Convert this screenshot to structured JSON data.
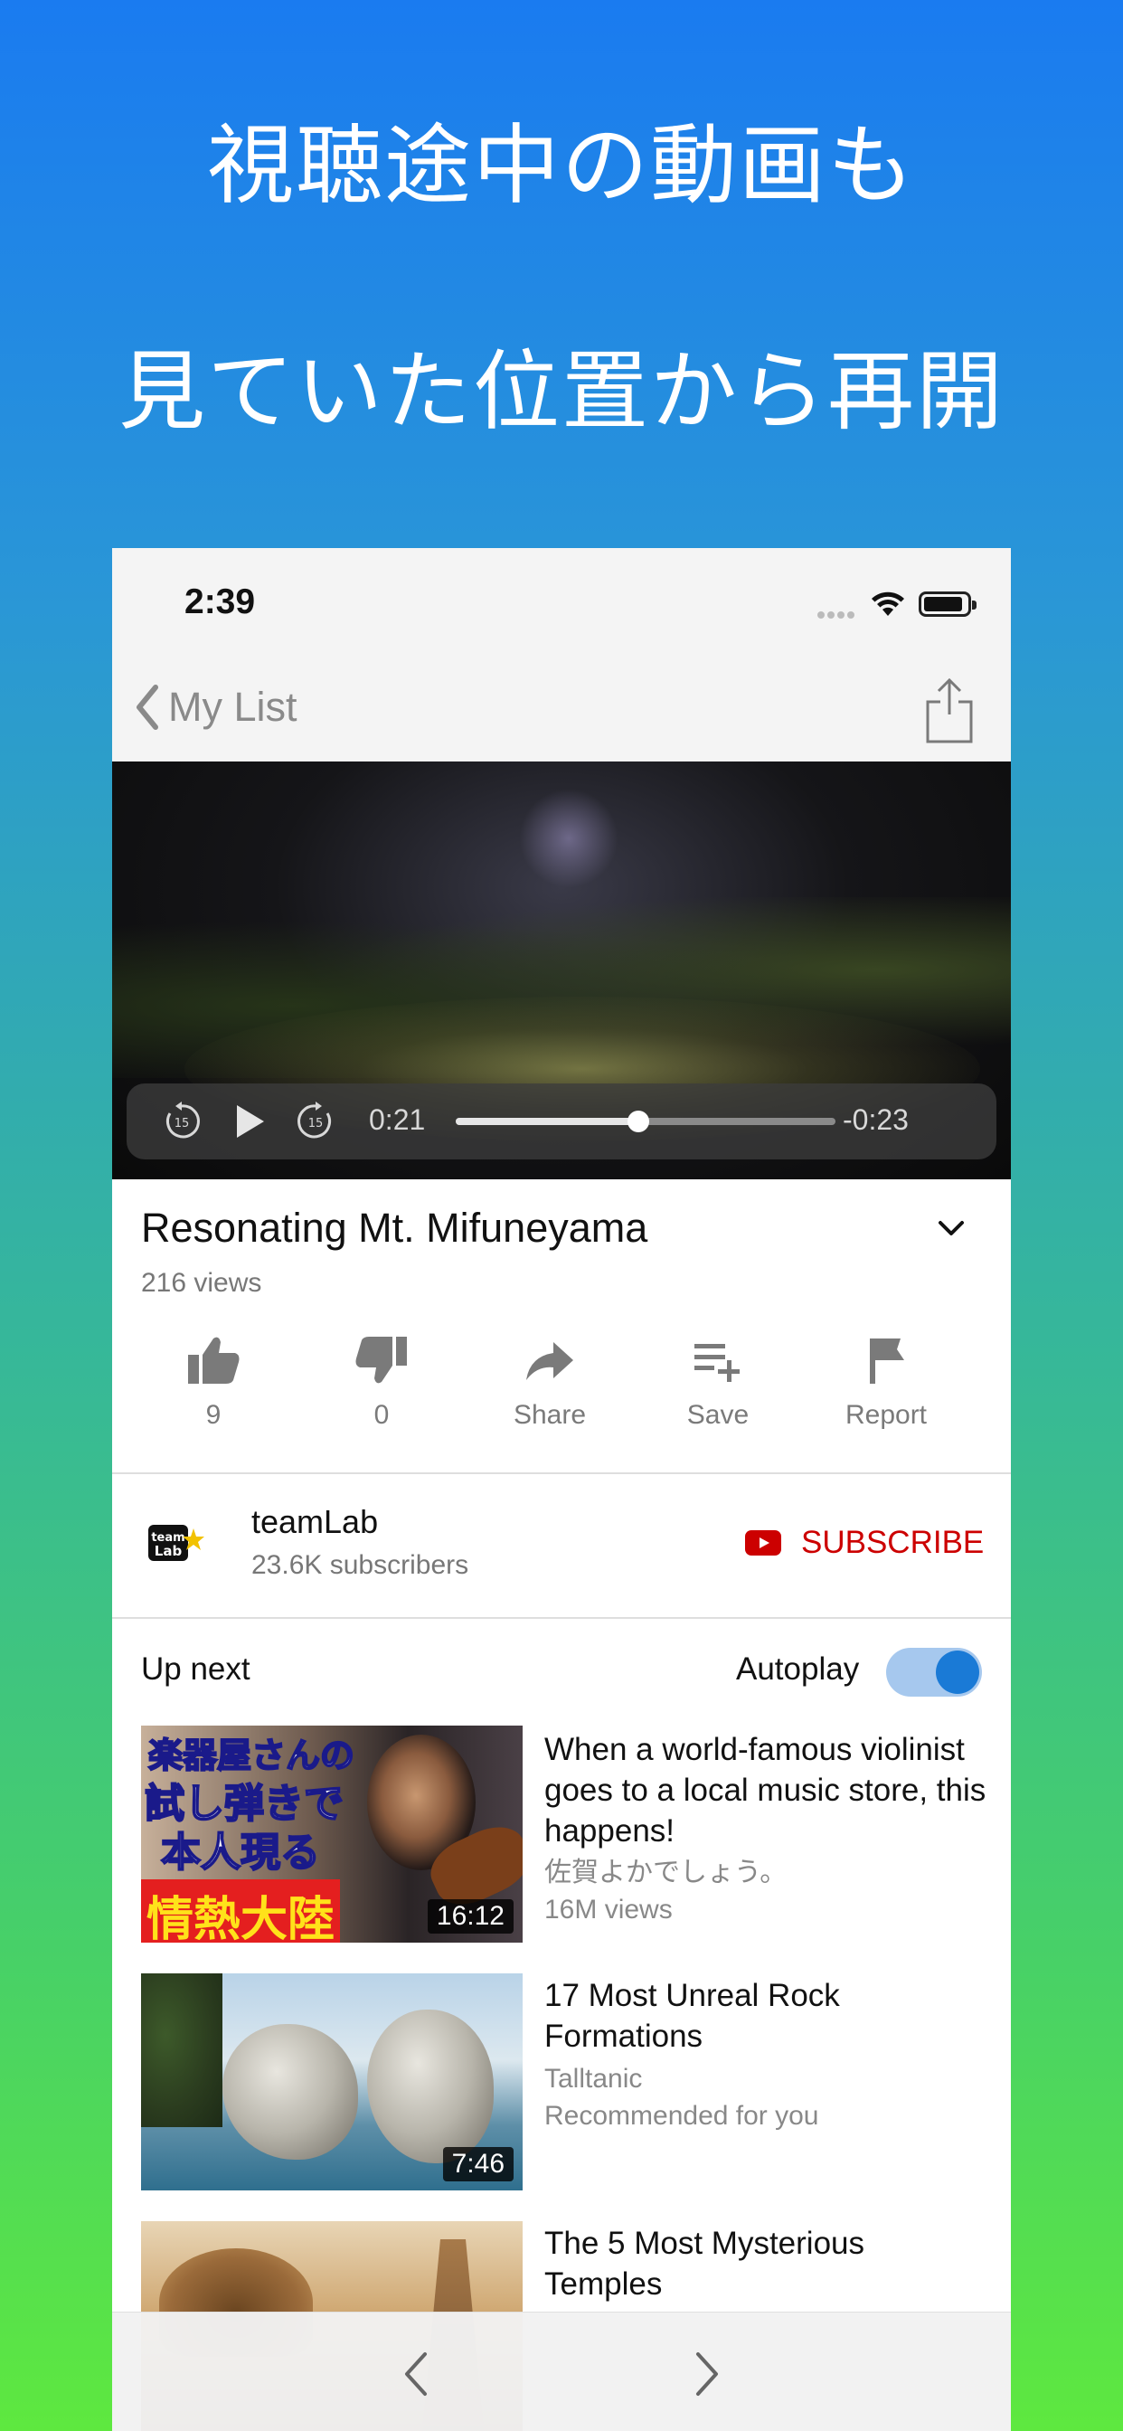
{
  "headline": {
    "line1": "視聴途中の動画も",
    "line2": "見ていた位置から再開"
  },
  "status_bar": {
    "time": "2:39"
  },
  "nav": {
    "back_label": "My List"
  },
  "player": {
    "current_time": "0:21",
    "remaining_time": "-0:23",
    "progress": 0.48
  },
  "video": {
    "title": "Resonating Mt. Mifuneyama",
    "views": "216 views"
  },
  "actions": [
    {
      "label": "9",
      "icon": "thumbs-up-icon"
    },
    {
      "label": "0",
      "icon": "thumbs-down-icon"
    },
    {
      "label": "Share",
      "icon": "share-arrow-icon"
    },
    {
      "label": "Save",
      "icon": "add-to-playlist-icon"
    },
    {
      "label": "Report",
      "icon": "flag-icon"
    }
  ],
  "channel": {
    "name": "teamLab",
    "subscribers": "23.6K subscribers",
    "subscribe_label": "SUBSCRIBE",
    "avatar_text": "team Lab"
  },
  "up_next": {
    "label": "Up next",
    "autoplay_label": "Autoplay",
    "autoplay_on": true,
    "items": [
      {
        "title": "When a world-famous violinist goes to a local music store, this happens!",
        "channel": "佐賀よかでしょう。",
        "meta": "16M views",
        "duration": "16:12",
        "thumb_text": [
          "楽器屋さんの",
          "試し弾きで",
          "本人現る",
          "情熱大陸"
        ]
      },
      {
        "title": "17 Most Unreal Rock Formations",
        "channel": "Talltanic",
        "meta": "Recommended for you",
        "duration": "7:46"
      },
      {
        "title": "The 5 Most Mysterious Temples"
      }
    ]
  },
  "colors": {
    "accent_blue": "#1a7ad6",
    "subscribe_red": "#cc0000",
    "gradient_top": "#1a7bf0",
    "gradient_bottom": "#5ee83f"
  }
}
